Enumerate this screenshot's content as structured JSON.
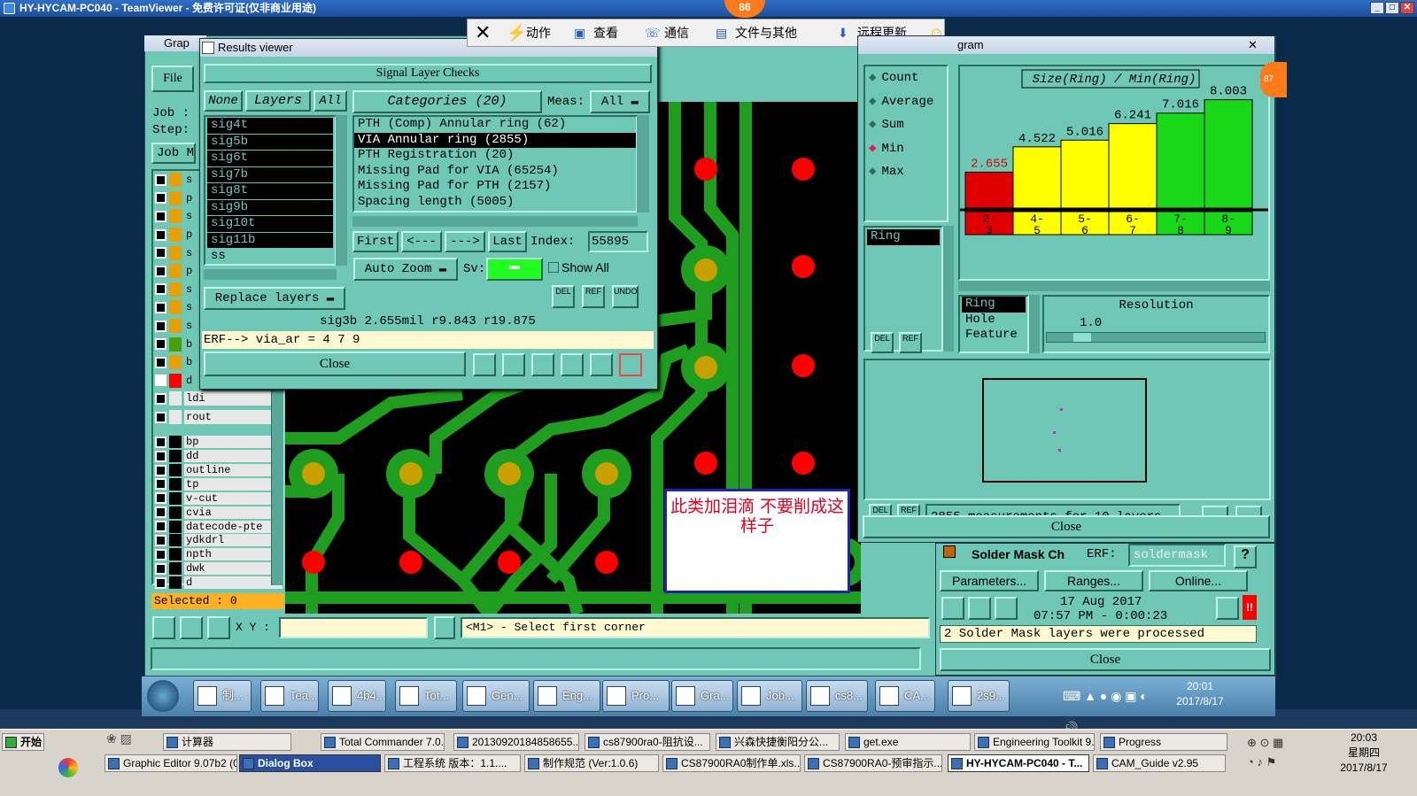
{
  "teamviewer": {
    "title": "HY-HYCAM-PC040 - TeamViewer - 免费许可证(仅非商业用途)",
    "toolbar": {
      "actions": "动作",
      "view": "查看",
      "comm": "通信",
      "files": "文件与其他",
      "update": "远程更新",
      "badge": "86"
    }
  },
  "graphic_editor": {
    "title": "Grap",
    "menu_file": "File",
    "job_label": "Job :",
    "step_label": "Step:",
    "job_btn": "Job M",
    "selected": "Selected : 0",
    "xy_label": "X Y :",
    "status": "<M1> - Select first corner",
    "layers": [
      {
        "label": "s",
        "color": "#e8a000",
        "checked": false
      },
      {
        "label": "p",
        "color": "#e8a000",
        "checked": false
      },
      {
        "label": "s",
        "color": "#e8a000",
        "checked": false
      },
      {
        "label": "p",
        "color": "#e8a000",
        "checked": false
      },
      {
        "label": "s",
        "color": "#e8a000",
        "checked": false
      },
      {
        "label": "p",
        "color": "#e8a000",
        "checked": false
      },
      {
        "label": "s",
        "color": "#e8a000",
        "checked": false
      },
      {
        "label": "s",
        "color": "#e8a000",
        "checked": false
      },
      {
        "label": "s",
        "color": "#e8a000",
        "checked": false
      },
      {
        "label": "b",
        "color": "#4aa000",
        "checked": false
      },
      {
        "label": "b",
        "color": "#e8a000",
        "checked": false
      },
      {
        "label": "d",
        "color": "#ff0000",
        "checked": true
      },
      {
        "label": "ldi",
        "color": "#e8e8e8",
        "checked": false
      },
      {
        "label": "rout",
        "color": "#e8e8e8",
        "checked": false
      }
    ],
    "layers2": [
      "bp",
      "dd",
      "outline",
      "tp",
      "v-cut",
      "cvia",
      "datecode-pte",
      "ydkdrl",
      "npth",
      "dwk",
      "d"
    ]
  },
  "results": {
    "title": "Results viewer",
    "header": "Signal Layer Checks",
    "none": "None",
    "layers": "Layers",
    "all": "All",
    "categories": "Categories (20)",
    "meas_label": "Meas:",
    "meas_val": "All",
    "layer_list": [
      "sig4t",
      "sig5b",
      "sig6t",
      "sig7b",
      "sig8t",
      "sig9b",
      "sig10t",
      "sig11b",
      "ss"
    ],
    "cat_list": [
      "PTH (Comp) Annular ring (62)",
      "VIA Annular ring (2855)",
      "PTH Registration (20)",
      "Missing Pad for VIA (65254)",
      "Missing Pad for PTH (2157)",
      "Spacing length (5005)"
    ],
    "first": "First",
    "prev": "<---",
    "next": "--->",
    "last": "Last",
    "index_label": "Index:",
    "index_val": "55895",
    "autozoom": "Auto Zoom",
    "sv": "Sv:",
    "showall": "Show All",
    "replace": "Replace layers",
    "del": "DEL",
    "ref": "REF",
    "undo": "UNDO",
    "info": "sig3b 2.655mil   r9.843   r19.875",
    "erf": "ERF--> via_ar = 4 7 9",
    "close": "Close"
  },
  "annotation": "此类加泪滴  不要削成这样子",
  "histogram": {
    "title_part": "gram",
    "stats": [
      "Count",
      "Average",
      "Sum",
      "Min",
      "Max"
    ],
    "selected_stat": "Min",
    "chart_title": "Size(Ring) / Min(Ring)",
    "ring_list": [
      "Ring"
    ],
    "sel_list": [
      "Ring",
      "Hole",
      "Feature"
    ],
    "resolution_label": "Resolution",
    "resolution_val": "1.0",
    "measurements": "2855 measurements for 10 layers",
    "close": "Close",
    "del": "DEL",
    "ref": "REF",
    "badge": "87"
  },
  "chart_data": {
    "type": "bar",
    "title": "Size(Ring) / Min(Ring)",
    "categories": [
      "2-3",
      "4-5",
      "5-6",
      "6-7",
      "7-8",
      "8-9"
    ],
    "values": [
      2.655,
      4.522,
      5.016,
      6.241,
      7.016,
      8.003
    ],
    "value_labels": [
      "2.655",
      "4.522",
      "5.016",
      "6.241",
      "7.016",
      "8.003"
    ],
    "colors": [
      "#e00000",
      "#ffff00",
      "#ffff00",
      "#ffff00",
      "#18d818",
      "#18d818"
    ],
    "ylim": [
      0,
      8.5
    ]
  },
  "soldermask": {
    "title": "Solder Mask Ch",
    "erf_label": "ERF:",
    "erf_val": "soldermask",
    "params": "Parameters...",
    "ranges": "Ranges...",
    "online": "Online...",
    "date": "17 Aug 2017",
    "time": "07:57 PM - 0:00:23",
    "message": "2 Solder Mask layers were processed",
    "close": "Close"
  },
  "taskbar1": {
    "items": [
      "制...",
      "Tea...",
      "4b4...",
      "Tot...",
      "Gen...",
      "Eng...",
      "Pro...",
      "Gra...",
      "Job...",
      "cs8...",
      "CA...",
      "2s9..."
    ],
    "time": "20:01",
    "date": "2017/8/17"
  },
  "taskbar2": {
    "start": "开始",
    "row1": [
      "计算器",
      "Total Commander 7.0...",
      "20130920184858655...",
      "cs87900ra0-阻抗设...",
      "兴森快捷衡阳分公...",
      "get.exe",
      "Engineering Toolkit 9...",
      "Progress"
    ],
    "row2": [
      "Graphic Editor 9.07b2 (0...",
      "Dialog Box",
      "工程系统  版本：1.1....",
      "制作规范 (Ver:1.0.6)",
      "CS87900RA0制作单.xls...",
      "CS87900RA0-预审指示...",
      "HY-HYCAM-PC040 - T...",
      "CAM_Guide v2.95"
    ],
    "time": "20:03",
    "day": "星期四",
    "date": "2017/8/17"
  }
}
